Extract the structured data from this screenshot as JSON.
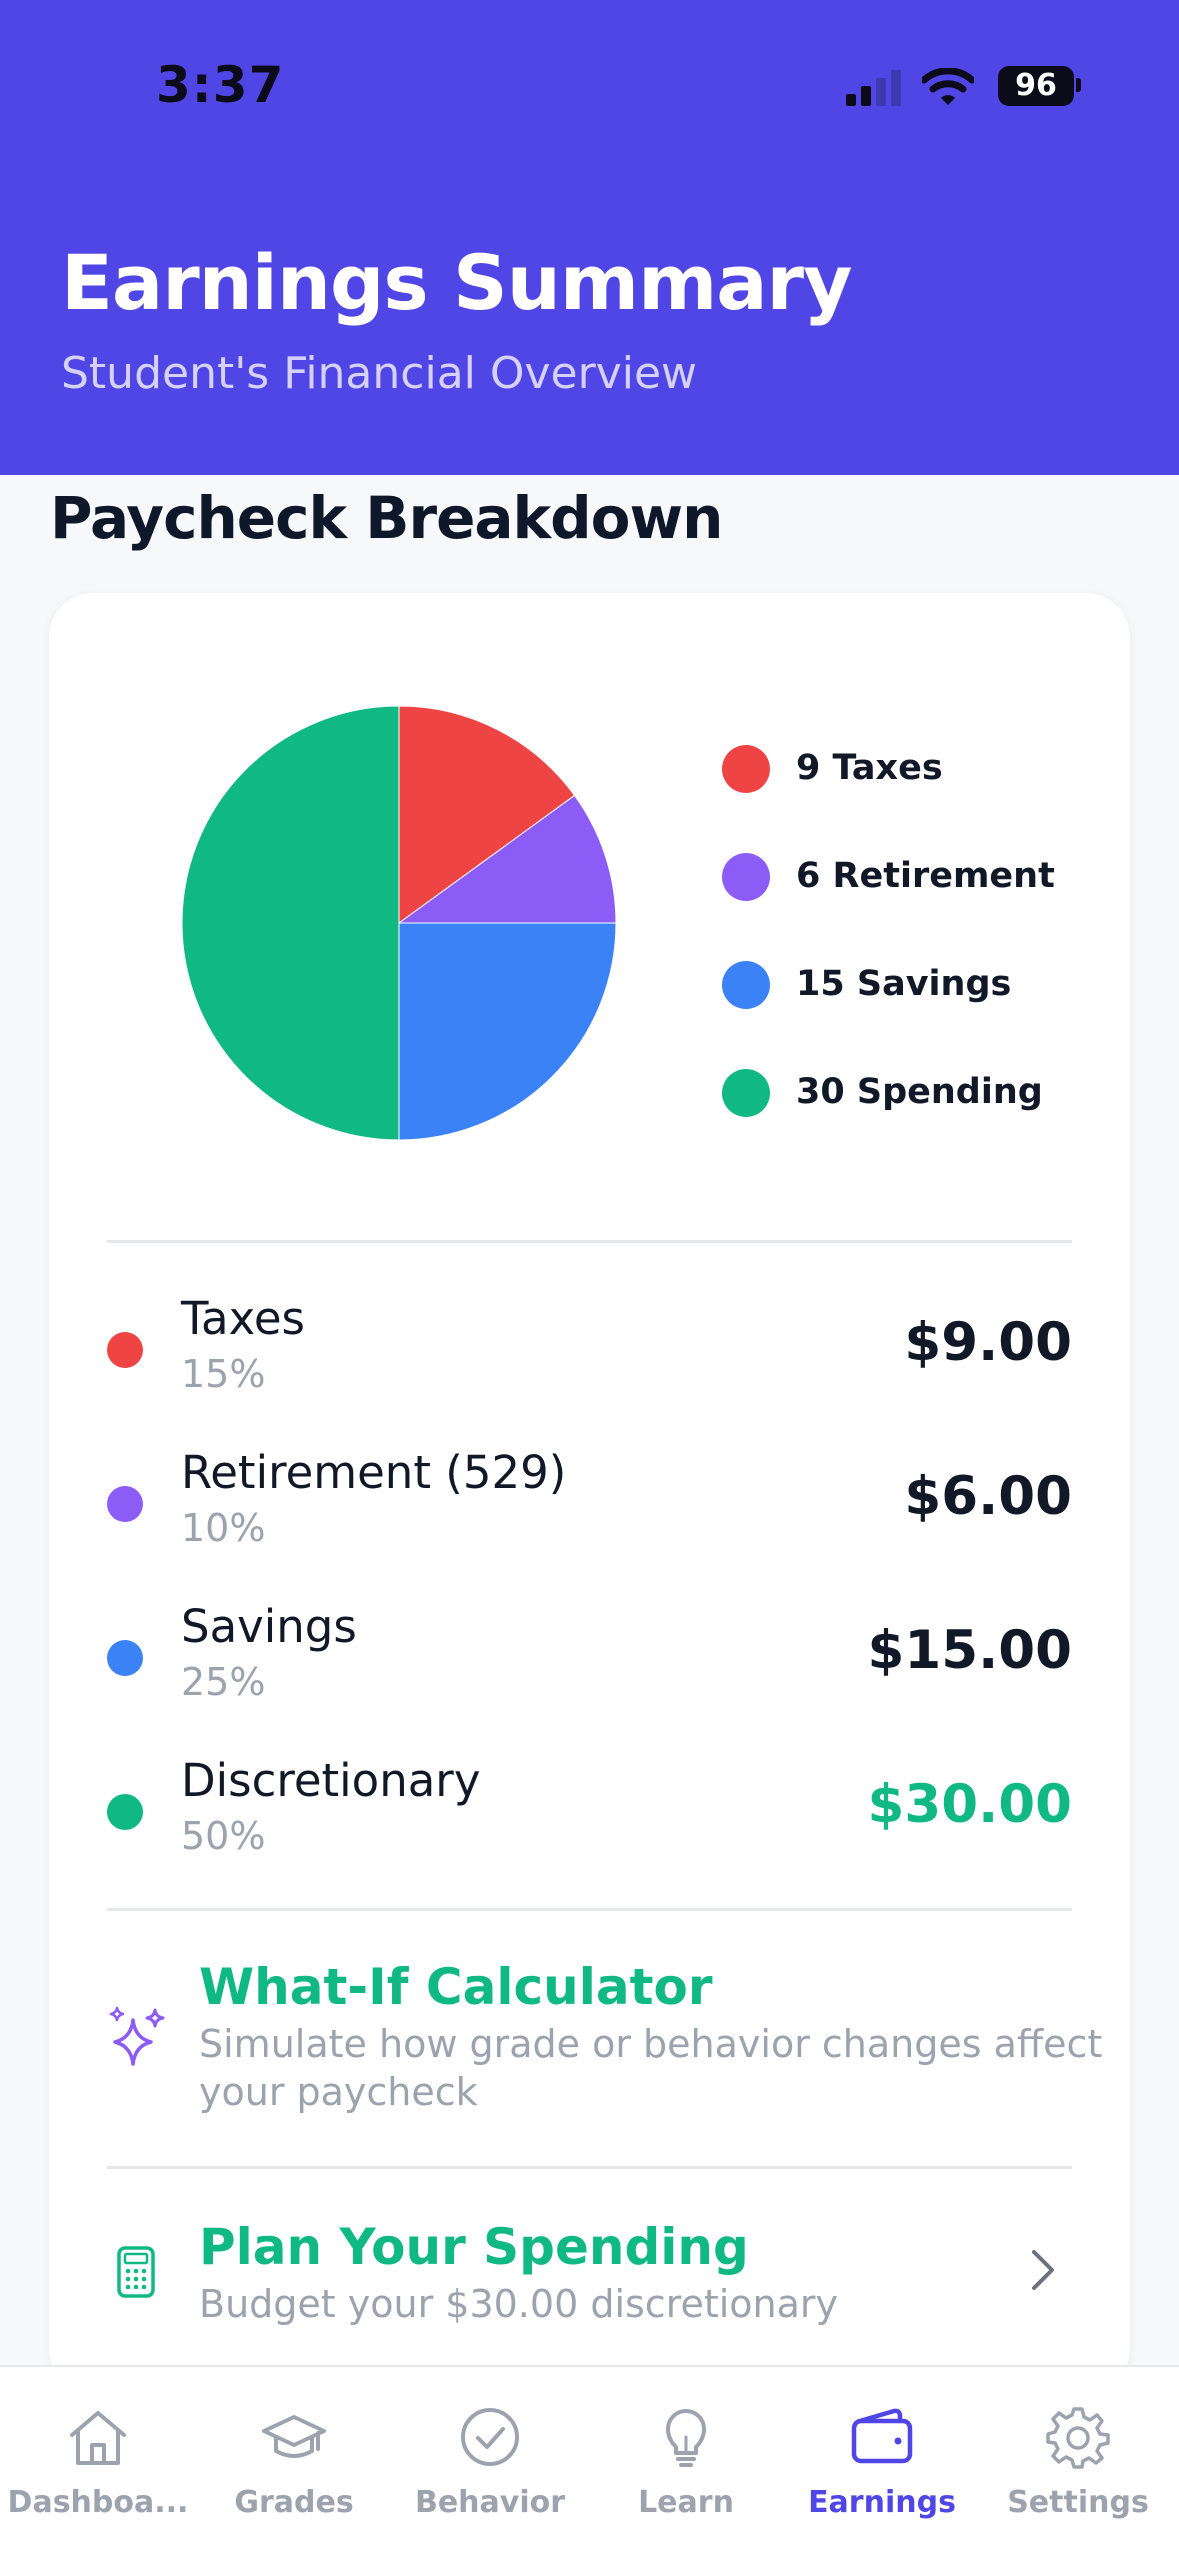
{
  "status_bar": {
    "time": "3:37",
    "battery": "96"
  },
  "header": {
    "title": "Earnings Summary",
    "subtitle": "Student's Financial Overview",
    "background_color": "#5046E5"
  },
  "section_title": "Paycheck Breakdown",
  "chart_data": {
    "type": "pie",
    "categories": [
      "Taxes",
      "Retirement",
      "Savings",
      "Spending"
    ],
    "values": [
      9,
      6,
      15,
      30
    ],
    "colors": [
      "#EF4444",
      "#8B5CF6",
      "#3B82F6",
      "#10B981"
    ],
    "legend_position": "right"
  },
  "legend": [
    {
      "label": "9 Taxes",
      "color": "#EF4444"
    },
    {
      "label": "6 Retirement",
      "color": "#8B5CF6"
    },
    {
      "label": "15 Savings",
      "color": "#3B82F6"
    },
    {
      "label": "30 Spending",
      "color": "#10B981"
    }
  ],
  "breakdown": [
    {
      "name": "Taxes",
      "percent": "15%",
      "amount": "$9.00",
      "color": "#EF4444"
    },
    {
      "name": "Retirement (529)",
      "percent": "10%",
      "amount": "$6.00",
      "color": "#8B5CF6"
    },
    {
      "name": "Savings",
      "percent": "25%",
      "amount": "$15.00",
      "color": "#3B82F6"
    },
    {
      "name": "Discretionary",
      "percent": "50%",
      "amount": "$30.00",
      "color": "#10B981"
    }
  ],
  "what_if": {
    "title": "What-If Calculator",
    "description": "Simulate how grade or behavior changes affect your paycheck",
    "icon": "sparkles-icon"
  },
  "plan": {
    "title": "Plan Your Spending",
    "description": "Budget your $30.00 discretionary",
    "icon": "calculator-icon"
  },
  "tabs": [
    {
      "label": "Dashboa...",
      "icon": "home-icon"
    },
    {
      "label": "Grades",
      "icon": "graduation-cap-icon"
    },
    {
      "label": "Behavior",
      "icon": "check-circle-icon"
    },
    {
      "label": "Learn",
      "icon": "lightbulb-icon"
    },
    {
      "label": "Earnings",
      "icon": "wallet-icon",
      "active": true
    },
    {
      "label": "Settings",
      "icon": "gear-icon"
    }
  ],
  "accent_color": "#4F46E5",
  "success_color": "#10B981"
}
